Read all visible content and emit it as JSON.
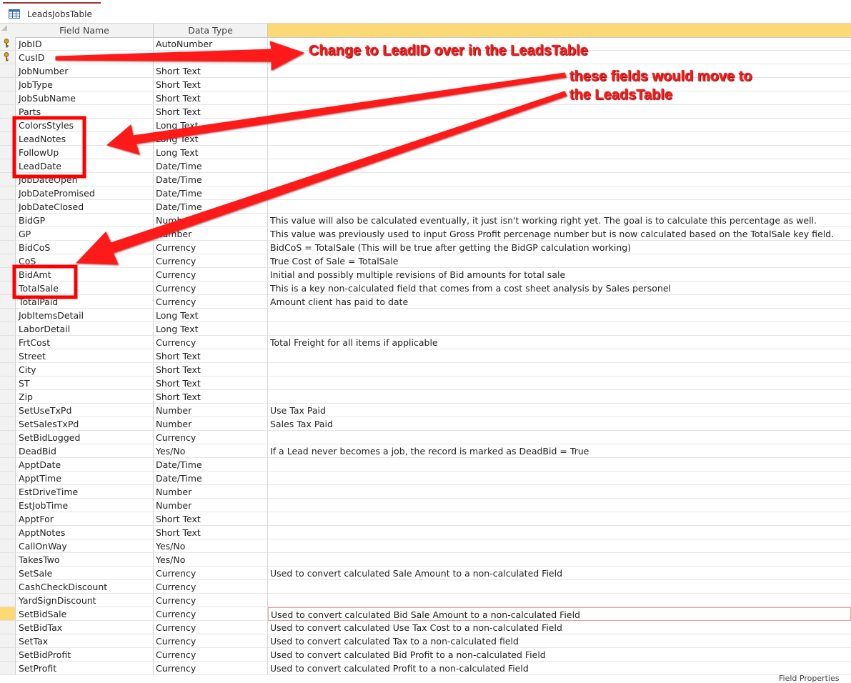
{
  "window": {
    "tab_title": "LeadsJobsTable",
    "tab_icon": "table-icon"
  },
  "grid": {
    "headers": {
      "field_name": "Field Name",
      "data_type": "Data Type"
    },
    "rows": [
      {
        "name": "JobID",
        "type": "AutoNumber",
        "desc": ""
      },
      {
        "name": "CusID",
        "type": "Number",
        "desc": ""
      },
      {
        "name": "JobNumber",
        "type": "Short Text",
        "desc": ""
      },
      {
        "name": "JobType",
        "type": "Short Text",
        "desc": ""
      },
      {
        "name": "JobSubName",
        "type": "Short Text",
        "desc": ""
      },
      {
        "name": "Parts",
        "type": "Short Text",
        "desc": ""
      },
      {
        "name": "ColorsStyles",
        "type": "Long Text",
        "desc": ""
      },
      {
        "name": "LeadNotes",
        "type": "Long Text",
        "desc": ""
      },
      {
        "name": "FollowUp",
        "type": "Long Text",
        "desc": ""
      },
      {
        "name": "LeadDate",
        "type": "Date/Time",
        "desc": ""
      },
      {
        "name": "JobDateOpen",
        "type": "Date/Time",
        "desc": ""
      },
      {
        "name": "JobDatePromised",
        "type": "Date/Time",
        "desc": ""
      },
      {
        "name": "JobDateClosed",
        "type": "Date/Time",
        "desc": ""
      },
      {
        "name": "BidGP",
        "type": "Number",
        "desc": "This value will also be calculated eventually, it just isn't working right yet. The goal is to calculate this percentage as well."
      },
      {
        "name": "GP",
        "type": "Number",
        "desc": "This value was previously used to input Gross Profit percenage number but is now calculated based on the TotalSale key field."
      },
      {
        "name": "BidCoS",
        "type": "Currency",
        "desc": "BidCoS = TotalSale (This will be true after getting the BidGP calculation working)"
      },
      {
        "name": "CoS",
        "type": "Currency",
        "desc": "True Cost of Sale = TotalSale"
      },
      {
        "name": "BidAmt",
        "type": "Currency",
        "desc": "Initial and possibly multiple revisions of Bid amounts for total sale"
      },
      {
        "name": "TotalSale",
        "type": "Currency",
        "desc": "This is a key non-calculated field that comes from a cost sheet analysis by Sales personel"
      },
      {
        "name": "TotalPaid",
        "type": "Currency",
        "desc": "Amount client has paid to date"
      },
      {
        "name": "JobItemsDetail",
        "type": "Long Text",
        "desc": ""
      },
      {
        "name": "LaborDetail",
        "type": "Long Text",
        "desc": ""
      },
      {
        "name": "FrtCost",
        "type": "Currency",
        "desc": "Total Freight for all items if applicable"
      },
      {
        "name": "Street",
        "type": "Short Text",
        "desc": ""
      },
      {
        "name": "City",
        "type": "Short Text",
        "desc": ""
      },
      {
        "name": "ST",
        "type": "Short Text",
        "desc": ""
      },
      {
        "name": "Zip",
        "type": "Short Text",
        "desc": ""
      },
      {
        "name": "SetUseTxPd",
        "type": "Number",
        "desc": "Use Tax Paid"
      },
      {
        "name": "SetSalesTxPd",
        "type": "Number",
        "desc": "Sales Tax Paid"
      },
      {
        "name": "SetBidLogged",
        "type": "Currency",
        "desc": ""
      },
      {
        "name": "DeadBid",
        "type": "Yes/No",
        "desc": "If a Lead never becomes a job, the record is marked as DeadBid = True"
      },
      {
        "name": "ApptDate",
        "type": "Date/Time",
        "desc": ""
      },
      {
        "name": "ApptTime",
        "type": "Date/Time",
        "desc": ""
      },
      {
        "name": "EstDriveTime",
        "type": "Number",
        "desc": ""
      },
      {
        "name": "EstJobTime",
        "type": "Number",
        "desc": ""
      },
      {
        "name": "ApptFor",
        "type": "Short Text",
        "desc": ""
      },
      {
        "name": "ApptNotes",
        "type": "Short Text",
        "desc": ""
      },
      {
        "name": "CallOnWay",
        "type": "Yes/No",
        "desc": ""
      },
      {
        "name": "TakesTwo",
        "type": "Yes/No",
        "desc": ""
      },
      {
        "name": "SetSale",
        "type": "Currency",
        "desc": "Used to convert calculated Sale Amount to a non-calculated Field"
      },
      {
        "name": "CashCheckDiscount",
        "type": "Currency",
        "desc": ""
      },
      {
        "name": "YardSignDiscount",
        "type": "Currency",
        "desc": ""
      },
      {
        "name": "SetBidSale",
        "type": "Currency",
        "desc": "Used to convert calculated Bid Sale Amount to a non-calculated Field"
      },
      {
        "name": "SetBidTax",
        "type": "Currency",
        "desc": "Used to convert calculated Use Tax Cost to a non-calculated Field"
      },
      {
        "name": "SetTax",
        "type": "Currency",
        "desc": "Used to convert calculated Tax to a non-calculated field"
      },
      {
        "name": "SetBidProfit",
        "type": "Currency",
        "desc": "Used to convert calculated Bid Profit to a non-calculated Field"
      },
      {
        "name": "SetProfit",
        "type": "Currency",
        "desc": "Used to convert calculated Profit to a non-calculated Field"
      }
    ],
    "primary_key_rows": [
      "JobID",
      "CusID"
    ],
    "active_row": "SetBidSale"
  },
  "annotations": {
    "note1": "Change to LeadID over in the LeadsTable",
    "note2_line1": "these fields would move to",
    "note2_line2": "the LeadsTable",
    "color": "#ff1a1a"
  },
  "footer": {
    "field_properties": "Field Properties"
  },
  "colors": {
    "accent_header": "#fbd974",
    "tab_accent": "#a4373a"
  }
}
